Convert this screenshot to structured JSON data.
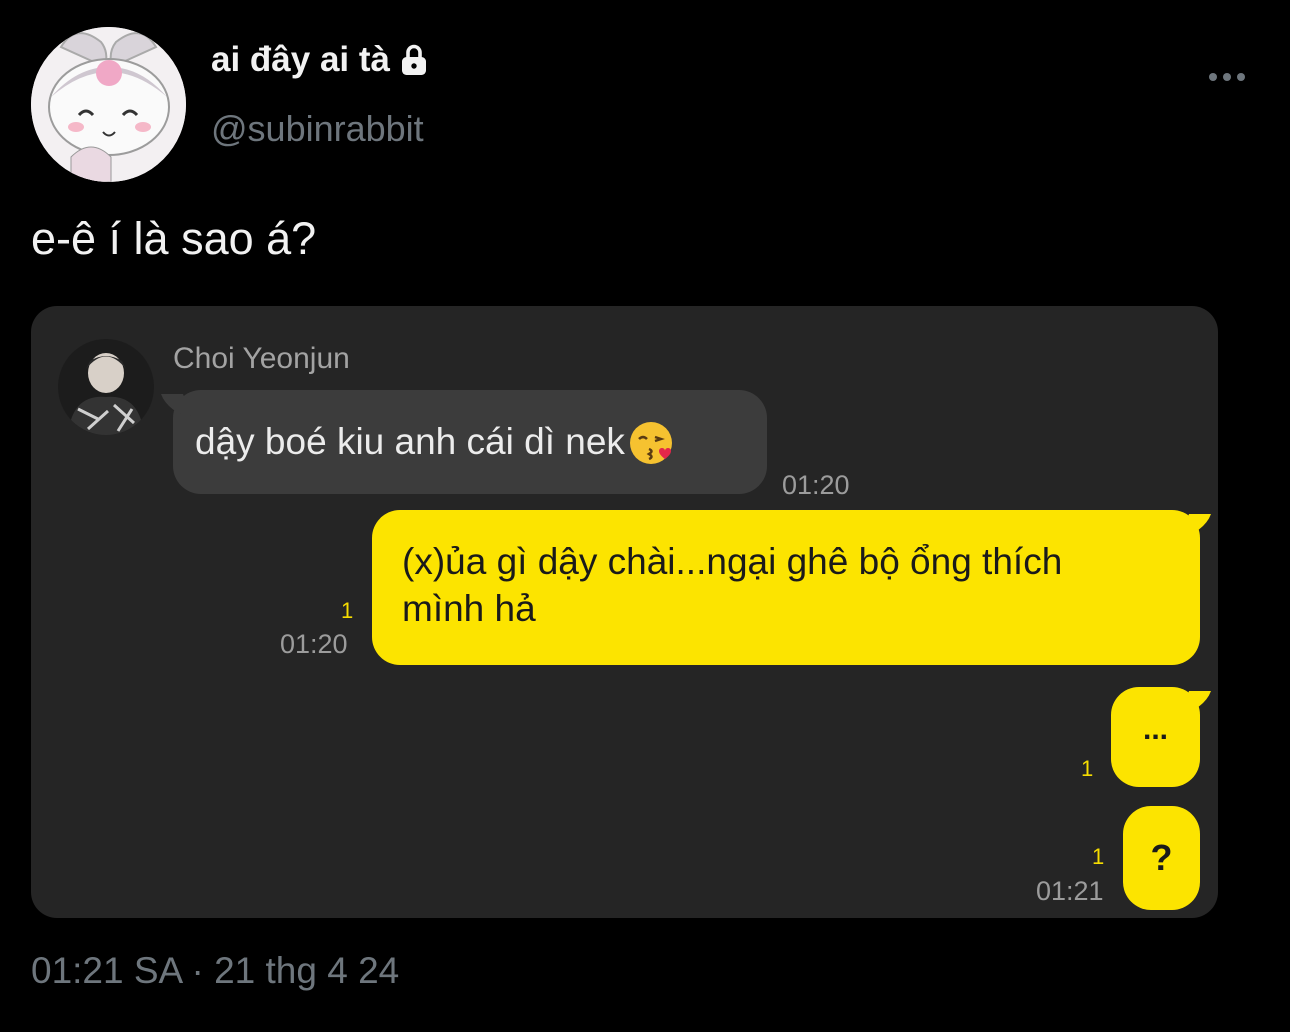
{
  "user": {
    "display_name": "ai đây ai tà",
    "handle": "@subinrabbit"
  },
  "tweet": {
    "text": "e-ê í là sao á?",
    "timestamp": "01:21 SA · 21 thg 4 24"
  },
  "chat": {
    "sender_name": "Choi Yeonjun",
    "incoming": {
      "text": "dậy boé kiu anh cái dì nek",
      "time": "01:20"
    },
    "outgoing": [
      {
        "text_line1": "(x)ủa gì dậy chài...ngại ghê bộ ổng thích",
        "text_line2": "mình hả",
        "unread": "1",
        "time": "01:20"
      },
      {
        "text": "...",
        "unread": "1"
      },
      {
        "text": "?",
        "unread": "1",
        "time": "01:21"
      }
    ]
  },
  "colors": {
    "background": "#000000",
    "media_bg": "#252525",
    "bubble_out": "#fce400",
    "bubble_in": "#3c3c3c",
    "handle": "#6e767d"
  },
  "icons": [
    "lock-icon",
    "more-options-icon",
    "kissing-face-emoji"
  ]
}
